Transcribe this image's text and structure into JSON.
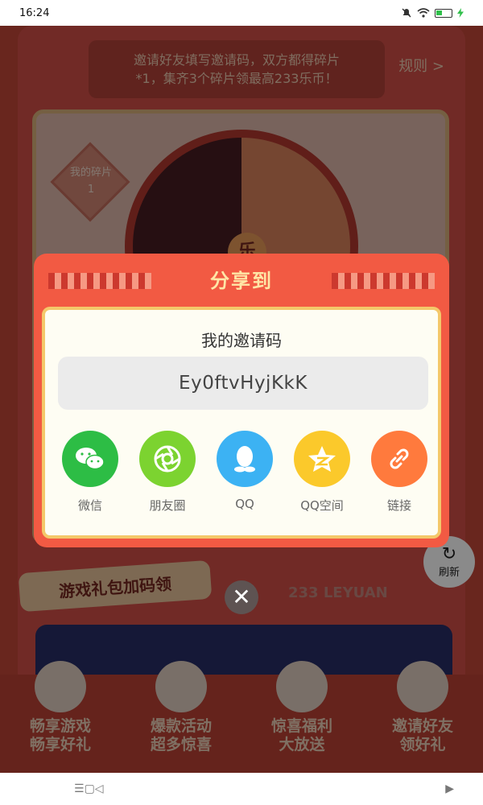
{
  "status_bar": {
    "time": "16:24"
  },
  "page": {
    "banner_line1": "邀请好友填写邀请码，双方都得碎片",
    "banner_line2": "*1，集齐3个碎片领最高233乐币！",
    "rules_label": "规则 >",
    "fragment_label": "我的碎片",
    "fragment_count": "1",
    "wheel_center": "乐",
    "gift_tag": "游戏礼包加码领",
    "brand_text": "233 LEYUAN",
    "refresh_label": "刷新",
    "features": [
      {
        "line1": "畅享游戏",
        "line2": "畅享好礼"
      },
      {
        "line1": "爆款活动",
        "line2": "超多惊喜"
      },
      {
        "line1": "惊喜福利",
        "line2": "大放送"
      },
      {
        "line1": "邀请好友",
        "line2": "领好礼"
      }
    ]
  },
  "share_modal": {
    "title": "分享到",
    "invite_label": "我的邀请码",
    "invite_code": "Ey0ftvHyjKkK",
    "options": [
      {
        "label": "微信",
        "icon": "wechat-icon",
        "color": "#2dbd45"
      },
      {
        "label": "朋友圈",
        "icon": "moments-icon",
        "color": "#7cd330"
      },
      {
        "label": "QQ",
        "icon": "qq-icon",
        "color": "#3cb2f3"
      },
      {
        "label": "QQ空间",
        "icon": "qzone-icon",
        "color": "#fbc92b"
      },
      {
        "label": "链接",
        "icon": "link-icon",
        "color": "#ff7a3d"
      }
    ]
  },
  "nav_bar": {
    "menu": "☰",
    "home": "▢",
    "back": "◁",
    "more": "▶"
  }
}
